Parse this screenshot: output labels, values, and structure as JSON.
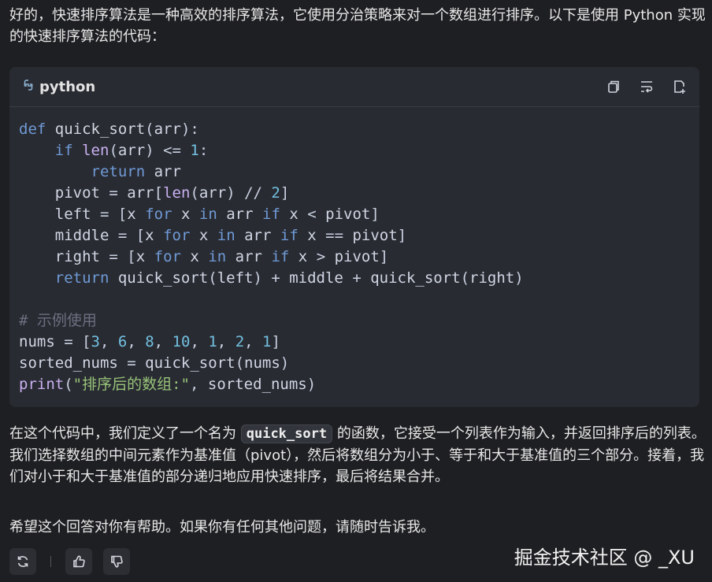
{
  "intro_text": "好的，快速排序算法是一种高效的排序算法，它使用分治策略来对一个数组进行排序。以下是使用 Python 实现的快速排序算法的代码：",
  "code_block": {
    "language": "python",
    "language_icon": "python-icon",
    "toolbar_icons": [
      "copy-icon",
      "wrap-icon",
      "insert-icon"
    ],
    "lines": [
      "def quick_sort(arr):",
      "    if len(arr) <= 1:",
      "        return arr",
      "    pivot = arr[len(arr) // 2]",
      "    left = [x for x in arr if x < pivot]",
      "    middle = [x for x in arr if x == pivot]",
      "    right = [x for x in arr if x > pivot]",
      "    return quick_sort(left) + middle + quick_sort(right)",
      "",
      "# 示例使用",
      "nums = [3, 6, 8, 10, 1, 2, 1]",
      "sorted_nums = quick_sort(nums)",
      "print(\"排序后的数组:\", sorted_nums)"
    ]
  },
  "explanation": {
    "before": "在这个代码中，我们定义了一个名为 ",
    "inline_code": "quick_sort",
    "after": " 的函数，它接受一个列表作为输入，并返回排序后的列表。我们选择数组的中间元素作为基准值（pivot），然后将数组分为小于、等于和大于基准值的三个部分。接着，我们对小于和大于基准值的部分递归地应用快速排序，最后将结果合并。"
  },
  "closing_text": "希望这个回答对你有帮助。如果你有任何其他问题，请随时告诉我。",
  "actions": {
    "icons": [
      "refresh-icon",
      "thumbs-up-icon",
      "thumbs-down-icon"
    ]
  },
  "watermark": "掘金技术社区 @ _XU",
  "colors": {
    "background": "#1e1f22",
    "code_background": "#292b32",
    "keyword": "#6f9ad6",
    "number": "#72c0e0",
    "string": "#98c379",
    "comment": "#6b7080"
  }
}
